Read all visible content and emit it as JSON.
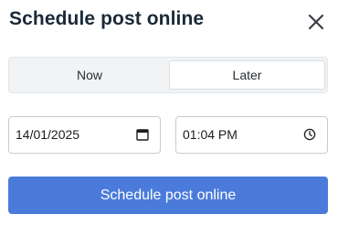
{
  "dialog": {
    "title": "Schedule post online",
    "close_icon": "close-icon"
  },
  "toggle": {
    "options": [
      {
        "label": "Now",
        "selected": false
      },
      {
        "label": "Later",
        "selected": true
      }
    ]
  },
  "date_field": {
    "value": "14/01/2025",
    "icon": "calendar-icon"
  },
  "time_field": {
    "value": "01:04 PM",
    "icon": "clock-icon"
  },
  "submit": {
    "label": "Schedule post online",
    "color": "#4a7bdb"
  },
  "colors": {
    "title": "#1b2a3a",
    "toggle_background": "#f1f3f5",
    "field_border": "#c6ccd3"
  }
}
